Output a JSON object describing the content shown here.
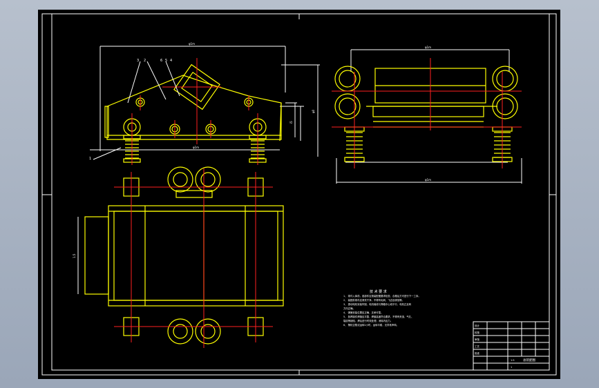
{
  "drawing": {
    "dimensions": {
      "front_overall_width": "φ1m",
      "front_height": "φ0",
      "front_small_height": "i5",
      "front_base_width": "φ1m",
      "side_top_width": "φ1m",
      "side_bottom_width": "φ1m",
      "plan_left_dim": "1.5"
    },
    "callouts": {
      "front_left": [
        "3",
        "2"
      ],
      "front_right": [
        "6",
        "5",
        "4"
      ],
      "front_bottom": "1"
    },
    "notes": {
      "title": "技 术 要 求",
      "lines": [
        "1、 零件入库前，各部件应按装配图要求检查，合格后方可进行下一工序。",
        "2、 装配前零件应清洗干净，不得有毛刺、飞边及锈蚀等。",
        "3、 振动电机安装牢固，电机轴线与筛箱中心线平行，电机正反转",
        "   方向正确。",
        "4、 弹簧安装位置应正确，支承可靠。",
        "5、 各焊接件焊缝应平整，焊缝高度符合要求，不得有夹渣、气孔、",
        "   裂纹等缺陷，焊后进行时效处理，消除内应力。",
        "6、 筛机空载试运转2小时，运转平稳，无异常声响。"
      ]
    },
    "title_block": {
      "drawing_name": "总装配图",
      "scale": "1:5",
      "sheet": "1",
      "rows": [
        "设计",
        "校核",
        "审核",
        "工艺",
        "批准"
      ]
    }
  }
}
